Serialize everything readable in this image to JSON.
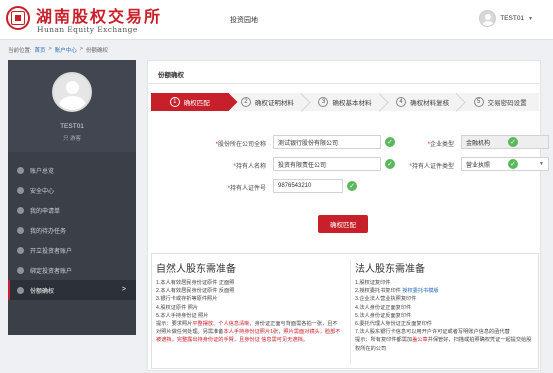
{
  "header": {
    "logo_cn": "湖南股权交易所",
    "logo_en": "Hunan Equity Exchange",
    "nav_link": "投资园地",
    "username": "TEST01"
  },
  "breadcrumb": {
    "prefix": "当前位置:",
    "home": "首页",
    "sep1": ">",
    "account_center": "账户中心",
    "sep2": ">",
    "current": "份额确权"
  },
  "sidebar": {
    "profile_name": "TEST01",
    "profile_role": "只 游客",
    "items": [
      {
        "label": "账户总览"
      },
      {
        "label": "安全中心"
      },
      {
        "label": "我的申请单"
      },
      {
        "label": "我的待办任务"
      },
      {
        "label": "开立投资者账户"
      },
      {
        "label": "绑定投资者账户"
      },
      {
        "label": "份额确权",
        "arrow": ">"
      }
    ]
  },
  "main": {
    "title": "份额确权",
    "steps": [
      {
        "num": "1",
        "label": "确权匹配"
      },
      {
        "num": "2",
        "label": "确权证明材料"
      },
      {
        "num": "3",
        "label": "确权基本材料"
      },
      {
        "num": "4",
        "label": "确权材料复核"
      },
      {
        "num": "5",
        "label": "交易密码设置"
      }
    ],
    "form": {
      "company_label": "股份所在公司全称",
      "company_value": "测试银行股份有限公司",
      "enterprise_type_label": "企业类型",
      "enterprise_type_value": "金融机构",
      "holder_name_label": "持有人名称",
      "holder_name_value": "投资有限责任公司",
      "holder_cert_type_label": "持有人证件类型",
      "holder_cert_type_value": "营业执照",
      "holder_cert_no_label": "持有人证件号",
      "holder_cert_no_value": "9876543210",
      "required_mark": "*",
      "check_mark": "✓",
      "submit_label": "确权匹配"
    },
    "info_left": {
      "title": "自然人股东需准备",
      "lines": [
        "1.本人有效居民身份证原件 正面照",
        "2.本人有效居民身份证原件 反面照",
        "3.银行卡或存折等原件照片",
        "4.股权证原件 照片",
        "5.本人手持身份证 照片"
      ],
      "tip_a": "提示：要求照片",
      "tip_a_red": "平整摆放、个人信息清晰",
      "tip_b": "，身份证正面与背面需各拍一张，且不对照片做任何处理。另需准备",
      "tip_b_red": "本人手持身份证照片1张",
      "tip_c": "，",
      "tip_c_red": "照片需面对镜头，脸部不被遮挡，完整露出持身份证的手臂，且身份证 信息需可见无遮挡。"
    },
    "info_right": {
      "title": "法人股东需准备",
      "lines": [
        "1.股权证复印件",
        "2.授权委托书复印件",
        "3.企业法人营业执照复印件",
        "4.法人身份证正面复印件",
        "5.法人身份证反面复印件",
        "6.委托代理人身份证正反面复印件",
        "7.法人股东银行卡信息可以用开户许可证或者写明账户信息的函代替"
      ],
      "line2_link": "授权委托书模版",
      "tip_a": "提示：所有复印件都需加",
      "tip_a_red": "盖公章",
      "tip_b": "并保管好，扫描或拍照确权凭证一起提交给股权所在的公司"
    }
  }
}
